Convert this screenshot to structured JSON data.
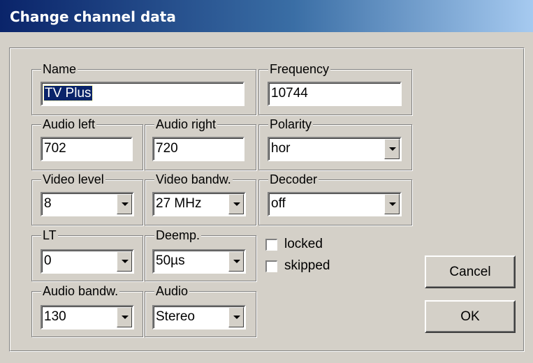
{
  "window": {
    "title": "Change channel data"
  },
  "groups": {
    "name": {
      "legend": "Name",
      "value": "TV Plus"
    },
    "frequency": {
      "legend": "Frequency",
      "value": "10744"
    },
    "audio_left": {
      "legend": "Audio left",
      "value": "702"
    },
    "audio_right": {
      "legend": "Audio right",
      "value": "720"
    },
    "polarity": {
      "legend": "Polarity",
      "value": "hor"
    },
    "video_level": {
      "legend": "Video level",
      "value": "8"
    },
    "video_bandw": {
      "legend": "Video bandw.",
      "value": "27 MHz"
    },
    "decoder": {
      "legend": "Decoder",
      "value": "off"
    },
    "lt": {
      "legend": "LT",
      "value": "0"
    },
    "deemp": {
      "legend": "Deemp.",
      "value": "50µs"
    },
    "audio_bandw": {
      "legend": "Audio bandw.",
      "value": "130"
    },
    "audio": {
      "legend": "Audio",
      "value": "Stereo"
    }
  },
  "checkboxes": {
    "locked": {
      "label": "locked",
      "checked": false
    },
    "skipped": {
      "label": "skipped",
      "checked": false
    }
  },
  "buttons": {
    "cancel": "Cancel",
    "ok": "OK"
  },
  "icons": {
    "dropdown": "chevron-down-icon"
  },
  "colors": {
    "title_gradient_start": "#0a246a",
    "title_gradient_end": "#a6caf0",
    "dialog_face": "#d4d0c8",
    "selection": "#0a246a"
  }
}
